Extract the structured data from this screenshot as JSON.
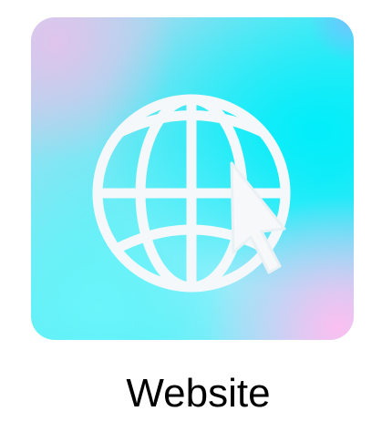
{
  "app": {
    "label": "Website",
    "icon": "globe-with-cursor-icon"
  }
}
